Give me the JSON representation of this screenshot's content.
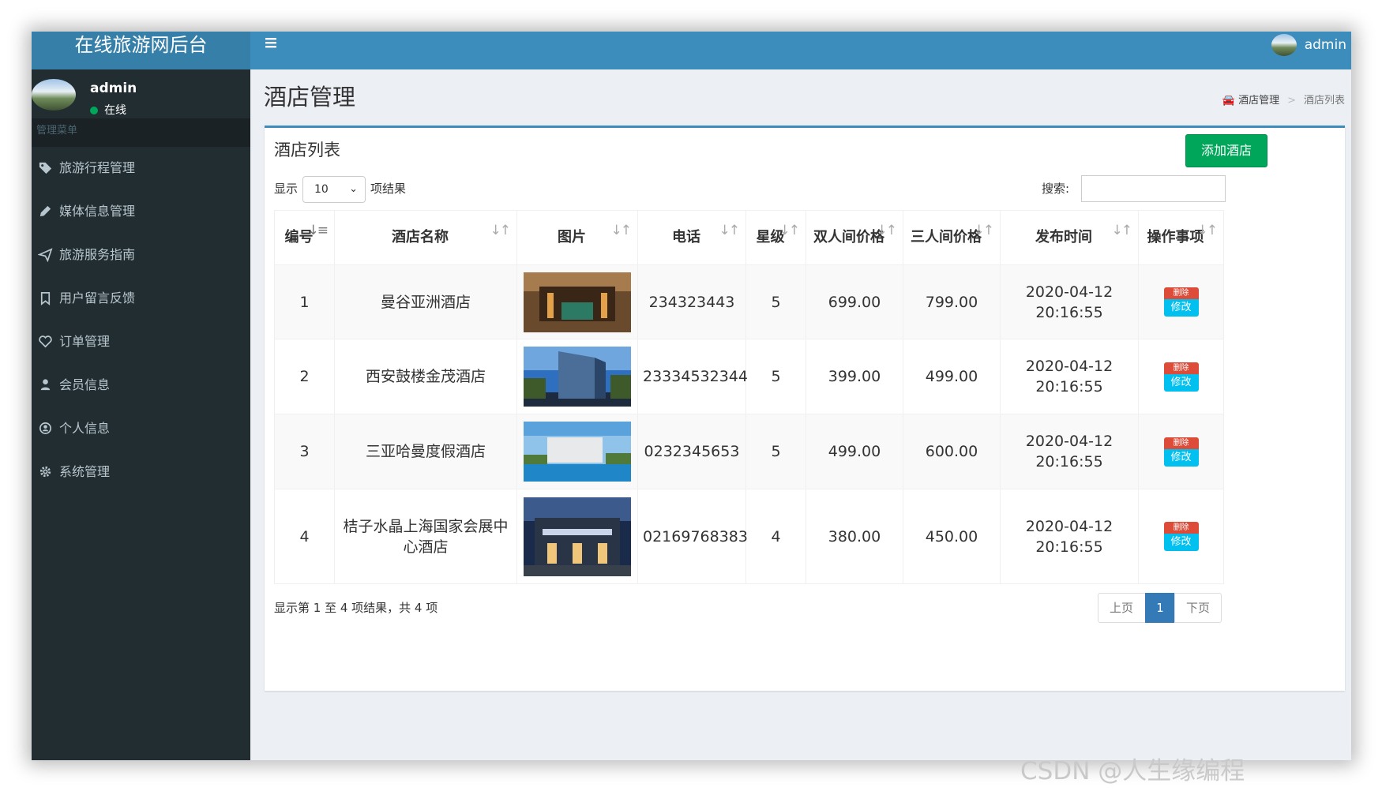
{
  "app": {
    "title": "在线旅游网后台"
  },
  "user": {
    "name": "admin",
    "status": "在线"
  },
  "sidebar": {
    "header": "管理菜单",
    "items": [
      {
        "label": "旅游行程管理",
        "icon": "tag-icon"
      },
      {
        "label": "媒体信息管理",
        "icon": "pencil-icon"
      },
      {
        "label": "旅游服务指南",
        "icon": "paper-plane-icon"
      },
      {
        "label": "用户留言反馈",
        "icon": "bookmark-icon"
      },
      {
        "label": "订单管理",
        "icon": "heart-icon"
      },
      {
        "label": "会员信息",
        "icon": "user-icon"
      },
      {
        "label": "个人信息",
        "icon": "user-circle-icon"
      },
      {
        "label": "系统管理",
        "icon": "gear-icon"
      }
    ]
  },
  "topbar": {
    "user": "admin"
  },
  "page": {
    "title": "酒店管理"
  },
  "breadcrumb": {
    "root": "酒店管理",
    "current": "酒店列表"
  },
  "box": {
    "title": "酒店列表",
    "add_button": "添加酒店"
  },
  "table_controls": {
    "show": "显示",
    "length": "10",
    "entries": "项结果",
    "search_label": "搜索:"
  },
  "table": {
    "columns": [
      "编号",
      "酒店名称",
      "图片",
      "电话",
      "星级",
      "双人间价格",
      "三人间价格",
      "发布时间",
      "操作事项"
    ],
    "rows": [
      {
        "id": "1",
        "name": "曼谷亚洲酒店",
        "phone": "234323443",
        "star": "5",
        "double": "699.00",
        "triple": "799.00",
        "date": "2020-04-12",
        "time": "20:16:55"
      },
      {
        "id": "2",
        "name": "西安鼓楼金茂酒店",
        "phone": "23334532344",
        "star": "5",
        "double": "399.00",
        "triple": "499.00",
        "date": "2020-04-12",
        "time": "20:16:55"
      },
      {
        "id": "3",
        "name": "三亚哈曼度假酒店",
        "phone": "0232345653",
        "star": "5",
        "double": "499.00",
        "triple": "600.00",
        "date": "2020-04-12",
        "time": "20:16:55"
      },
      {
        "id": "4",
        "name": "桔子水晶上海国家会展中心酒店",
        "phone": "02169768383",
        "star": "4",
        "double": "380.00",
        "triple": "450.00",
        "date": "2020-04-12",
        "time": "20:16:55"
      }
    ],
    "delete_label": "删除",
    "edit_label": "修改"
  },
  "footer": {
    "info": "显示第 1 至 4 项结果，共 4 项",
    "prev": "上页",
    "page": "1",
    "next": "下页"
  },
  "watermark": "CSDN @人生缘编程",
  "colors": {
    "topbar": "#3c8dbc",
    "sidebar": "#222d32",
    "accent": "#00a65a",
    "primary": "#337ab7"
  }
}
